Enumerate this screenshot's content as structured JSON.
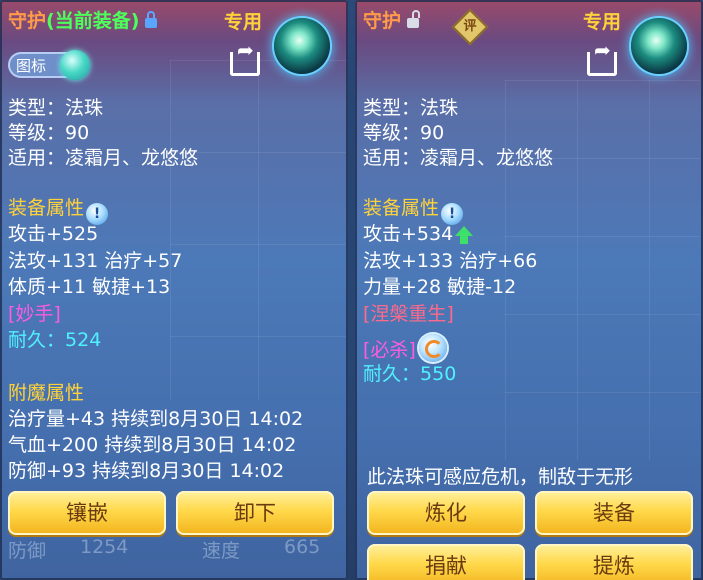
{
  "left_panel": {
    "title_main": "守护",
    "title_tag": "(当前装备)",
    "exclusive": "专用",
    "icon_toggle_label": "图标",
    "type_line": "类型：法珠",
    "level_line": "等级：90",
    "applicable_line": "适用：凌霜月、龙悠悠",
    "equip_attr_heading": "装备属性",
    "attack_line": "攻击+525",
    "magic_heal_line": "法攻+131 治疗+57",
    "con_agi_line": "体质+11 敏捷+13",
    "special_tag": "[妙手]",
    "durability_label": "耐久：",
    "durability_value": "524",
    "enchant_heading": "附魔属性",
    "enchant_lines": [
      "治疗量+43 持续到8月30日 14:02",
      "气血+200 持续到8月30日 14:02",
      "防御+93 持续到8月30日 14:02"
    ],
    "button_inlay": "镶嵌",
    "button_unequip": "卸下",
    "underlay_text": [
      "防御",
      "1254",
      "速度",
      "665"
    ]
  },
  "right_panel": {
    "title_main": "守护",
    "rating_badge": "评",
    "exclusive": "专用",
    "type_line": "类型：法珠",
    "level_line": "等级：90",
    "applicable_line": "适用：凌霜月、龙悠悠",
    "equip_attr_heading": "装备属性",
    "attack_line": "攻击+534",
    "magic_heal_line": "法攻+133 治疗+66",
    "str_agi_line": "力量+28 敏捷-12",
    "nirvana_tag": "[涅槃重生]",
    "crit_tag": "[必杀]",
    "durability_label": "耐久：",
    "durability_value": "550",
    "description": "此法珠可感应危机，制敌于无形",
    "button_refine": "炼化",
    "button_equip": "装备",
    "button_donate": "捐献",
    "button_extract": "提炼"
  },
  "colors": {
    "title_orange": "#ff9b4a",
    "title_green": "#4dff5a",
    "heading_gold": "#ffd23a",
    "tag_magenta": "#ff5be3",
    "tag_pinkred": "#ff6a8a",
    "durability_cyan": "#4ff2ff",
    "button_gold": "#ffd94a"
  },
  "icons": [
    "lock-icon",
    "unlock-icon",
    "rating-badge-icon",
    "share-icon",
    "orb-item-icon",
    "info-icon",
    "up-arrow-icon",
    "skill-orb-icon"
  ]
}
